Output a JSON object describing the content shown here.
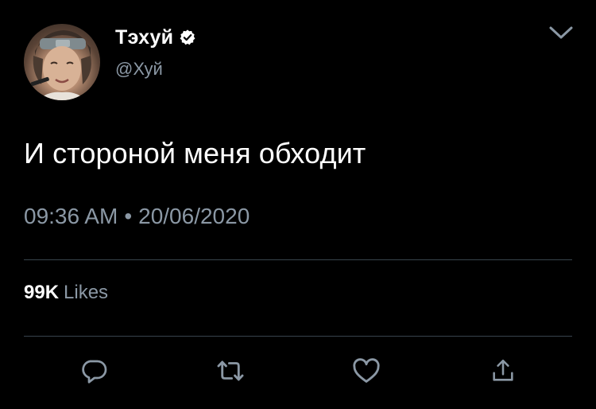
{
  "author": {
    "display_name": "Тэхуй",
    "handle": "@Хуй",
    "verified_icon": "verified-badge-icon",
    "avatar": "profile-photo"
  },
  "tweet": {
    "text": "И стороной меня обходит",
    "time": "09:36 AM",
    "separator": "•",
    "date": "20/06/2020"
  },
  "stats": {
    "likes_count": "99K",
    "likes_label": "Likes"
  },
  "actions": [
    {
      "name": "reply",
      "icon": "reply-icon"
    },
    {
      "name": "retweet",
      "icon": "retweet-icon"
    },
    {
      "name": "like",
      "icon": "heart-icon"
    },
    {
      "name": "share",
      "icon": "share-icon"
    }
  ],
  "menu_icon": "chevron-down-icon",
  "colors": {
    "background": "#000000",
    "text_primary": "#ffffff",
    "text_secondary": "#8b98a5",
    "divider": "#38444d"
  }
}
